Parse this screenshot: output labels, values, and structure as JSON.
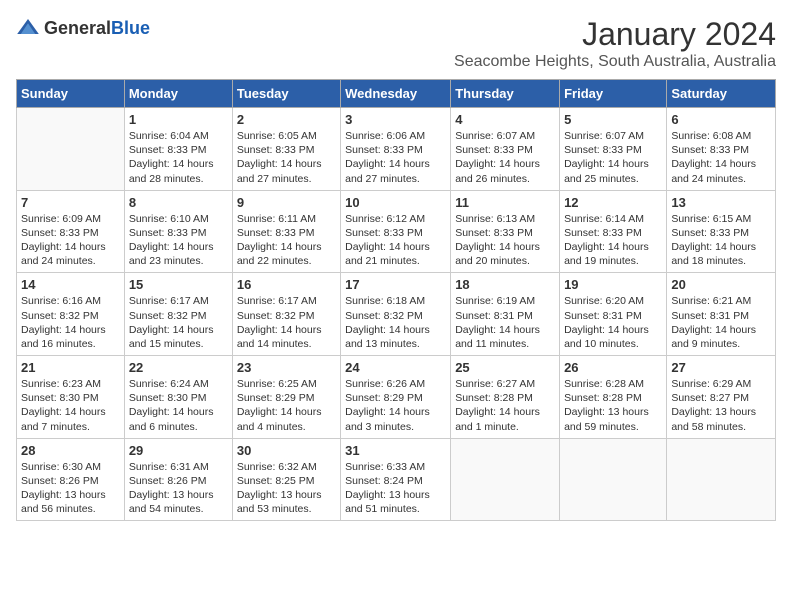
{
  "header": {
    "logo_general": "General",
    "logo_blue": "Blue",
    "title": "January 2024",
    "subtitle": "Seacombe Heights, South Australia, Australia"
  },
  "weekdays": [
    "Sunday",
    "Monday",
    "Tuesday",
    "Wednesday",
    "Thursday",
    "Friday",
    "Saturday"
  ],
  "weeks": [
    [
      {
        "day": "",
        "sunrise": "",
        "sunset": "",
        "daylight": ""
      },
      {
        "day": "1",
        "sunrise": "Sunrise: 6:04 AM",
        "sunset": "Sunset: 8:33 PM",
        "daylight": "Daylight: 14 hours and 28 minutes."
      },
      {
        "day": "2",
        "sunrise": "Sunrise: 6:05 AM",
        "sunset": "Sunset: 8:33 PM",
        "daylight": "Daylight: 14 hours and 27 minutes."
      },
      {
        "day": "3",
        "sunrise": "Sunrise: 6:06 AM",
        "sunset": "Sunset: 8:33 PM",
        "daylight": "Daylight: 14 hours and 27 minutes."
      },
      {
        "day": "4",
        "sunrise": "Sunrise: 6:07 AM",
        "sunset": "Sunset: 8:33 PM",
        "daylight": "Daylight: 14 hours and 26 minutes."
      },
      {
        "day": "5",
        "sunrise": "Sunrise: 6:07 AM",
        "sunset": "Sunset: 8:33 PM",
        "daylight": "Daylight: 14 hours and 25 minutes."
      },
      {
        "day": "6",
        "sunrise": "Sunrise: 6:08 AM",
        "sunset": "Sunset: 8:33 PM",
        "daylight": "Daylight: 14 hours and 24 minutes."
      }
    ],
    [
      {
        "day": "7",
        "sunrise": "Sunrise: 6:09 AM",
        "sunset": "Sunset: 8:33 PM",
        "daylight": "Daylight: 14 hours and 24 minutes."
      },
      {
        "day": "8",
        "sunrise": "Sunrise: 6:10 AM",
        "sunset": "Sunset: 8:33 PM",
        "daylight": "Daylight: 14 hours and 23 minutes."
      },
      {
        "day": "9",
        "sunrise": "Sunrise: 6:11 AM",
        "sunset": "Sunset: 8:33 PM",
        "daylight": "Daylight: 14 hours and 22 minutes."
      },
      {
        "day": "10",
        "sunrise": "Sunrise: 6:12 AM",
        "sunset": "Sunset: 8:33 PM",
        "daylight": "Daylight: 14 hours and 21 minutes."
      },
      {
        "day": "11",
        "sunrise": "Sunrise: 6:13 AM",
        "sunset": "Sunset: 8:33 PM",
        "daylight": "Daylight: 14 hours and 20 minutes."
      },
      {
        "day": "12",
        "sunrise": "Sunrise: 6:14 AM",
        "sunset": "Sunset: 8:33 PM",
        "daylight": "Daylight: 14 hours and 19 minutes."
      },
      {
        "day": "13",
        "sunrise": "Sunrise: 6:15 AM",
        "sunset": "Sunset: 8:33 PM",
        "daylight": "Daylight: 14 hours and 18 minutes."
      }
    ],
    [
      {
        "day": "14",
        "sunrise": "Sunrise: 6:16 AM",
        "sunset": "Sunset: 8:32 PM",
        "daylight": "Daylight: 14 hours and 16 minutes."
      },
      {
        "day": "15",
        "sunrise": "Sunrise: 6:17 AM",
        "sunset": "Sunset: 8:32 PM",
        "daylight": "Daylight: 14 hours and 15 minutes."
      },
      {
        "day": "16",
        "sunrise": "Sunrise: 6:17 AM",
        "sunset": "Sunset: 8:32 PM",
        "daylight": "Daylight: 14 hours and 14 minutes."
      },
      {
        "day": "17",
        "sunrise": "Sunrise: 6:18 AM",
        "sunset": "Sunset: 8:32 PM",
        "daylight": "Daylight: 14 hours and 13 minutes."
      },
      {
        "day": "18",
        "sunrise": "Sunrise: 6:19 AM",
        "sunset": "Sunset: 8:31 PM",
        "daylight": "Daylight: 14 hours and 11 minutes."
      },
      {
        "day": "19",
        "sunrise": "Sunrise: 6:20 AM",
        "sunset": "Sunset: 8:31 PM",
        "daylight": "Daylight: 14 hours and 10 minutes."
      },
      {
        "day": "20",
        "sunrise": "Sunrise: 6:21 AM",
        "sunset": "Sunset: 8:31 PM",
        "daylight": "Daylight: 14 hours and 9 minutes."
      }
    ],
    [
      {
        "day": "21",
        "sunrise": "Sunrise: 6:23 AM",
        "sunset": "Sunset: 8:30 PM",
        "daylight": "Daylight: 14 hours and 7 minutes."
      },
      {
        "day": "22",
        "sunrise": "Sunrise: 6:24 AM",
        "sunset": "Sunset: 8:30 PM",
        "daylight": "Daylight: 14 hours and 6 minutes."
      },
      {
        "day": "23",
        "sunrise": "Sunrise: 6:25 AM",
        "sunset": "Sunset: 8:29 PM",
        "daylight": "Daylight: 14 hours and 4 minutes."
      },
      {
        "day": "24",
        "sunrise": "Sunrise: 6:26 AM",
        "sunset": "Sunset: 8:29 PM",
        "daylight": "Daylight: 14 hours and 3 minutes."
      },
      {
        "day": "25",
        "sunrise": "Sunrise: 6:27 AM",
        "sunset": "Sunset: 8:28 PM",
        "daylight": "Daylight: 14 hours and 1 minute."
      },
      {
        "day": "26",
        "sunrise": "Sunrise: 6:28 AM",
        "sunset": "Sunset: 8:28 PM",
        "daylight": "Daylight: 13 hours and 59 minutes."
      },
      {
        "day": "27",
        "sunrise": "Sunrise: 6:29 AM",
        "sunset": "Sunset: 8:27 PM",
        "daylight": "Daylight: 13 hours and 58 minutes."
      }
    ],
    [
      {
        "day": "28",
        "sunrise": "Sunrise: 6:30 AM",
        "sunset": "Sunset: 8:26 PM",
        "daylight": "Daylight: 13 hours and 56 minutes."
      },
      {
        "day": "29",
        "sunrise": "Sunrise: 6:31 AM",
        "sunset": "Sunset: 8:26 PM",
        "daylight": "Daylight: 13 hours and 54 minutes."
      },
      {
        "day": "30",
        "sunrise": "Sunrise: 6:32 AM",
        "sunset": "Sunset: 8:25 PM",
        "daylight": "Daylight: 13 hours and 53 minutes."
      },
      {
        "day": "31",
        "sunrise": "Sunrise: 6:33 AM",
        "sunset": "Sunset: 8:24 PM",
        "daylight": "Daylight: 13 hours and 51 minutes."
      },
      {
        "day": "",
        "sunrise": "",
        "sunset": "",
        "daylight": ""
      },
      {
        "day": "",
        "sunrise": "",
        "sunset": "",
        "daylight": ""
      },
      {
        "day": "",
        "sunrise": "",
        "sunset": "",
        "daylight": ""
      }
    ]
  ]
}
